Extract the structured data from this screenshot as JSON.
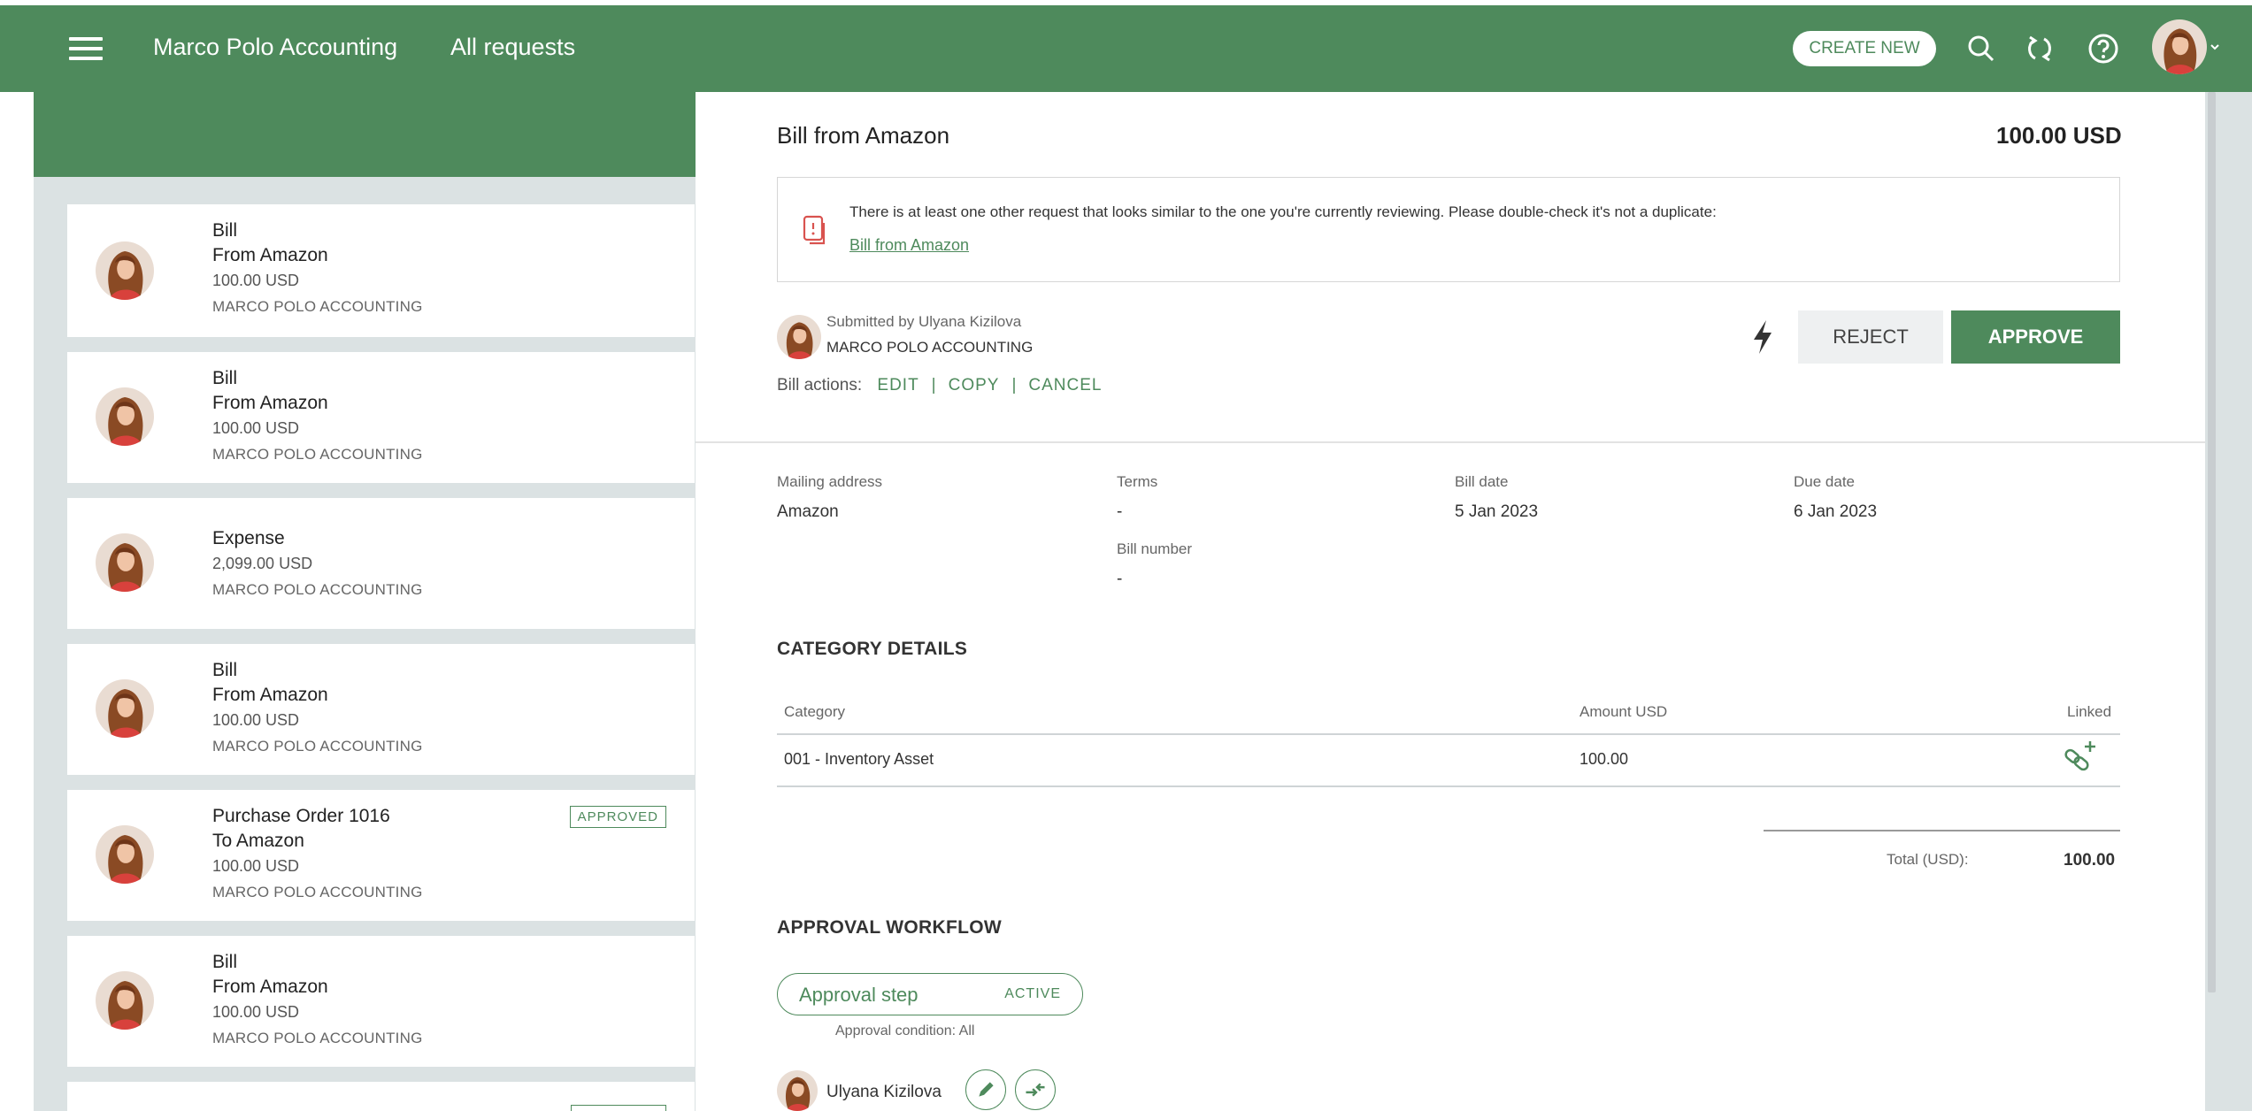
{
  "header": {
    "company": "Marco Polo Accounting",
    "page": "All requests",
    "create_label": "CREATE NEW",
    "icons": [
      "menu-icon",
      "chevron-right-icon",
      "search-icon",
      "sync-icon",
      "help-icon",
      "avatar",
      "caret-down-icon"
    ]
  },
  "colors": {
    "brand": "#4e8a5c",
    "panel": "#dbe2e3",
    "reject_bg": "#eef0f1"
  },
  "requests": [
    {
      "line1": "Bill",
      "line2": "From Amazon",
      "amount": "100.00 USD",
      "org": "MARCO POLO ACCOUNTING",
      "selected": true
    },
    {
      "line1": "Bill",
      "line2": "From Amazon",
      "amount": "100.00 USD",
      "org": "MARCO POLO ACCOUNTING"
    },
    {
      "line1": "Expense",
      "amount": "2,099.00 USD",
      "org": "MARCO POLO ACCOUNTING"
    },
    {
      "line1": "Bill",
      "line2": "From Amazon",
      "amount": "100.00 USD",
      "org": "MARCO POLO ACCOUNTING"
    },
    {
      "line1": "Purchase Order 1016",
      "line2": "To Amazon",
      "amount": "100.00 USD",
      "org": "MARCO POLO ACCOUNTING",
      "badge": "APPROVED"
    },
    {
      "line1": "Bill",
      "line2": "From Amazon",
      "amount": "100.00 USD",
      "org": "MARCO POLO ACCOUNTING"
    }
  ],
  "detail": {
    "title": "Bill from Amazon",
    "amount": "100.00 USD",
    "duplicate_notice": "There is at least one other request that looks similar to the one you're currently reviewing. Please double-check it's not a duplicate:",
    "duplicate_link": "Bill from Amazon",
    "submitted_by": "Submitted by Ulyana Kizilova",
    "submitter_org": "MARCO POLO ACCOUNTING",
    "bill_actions_label": "Bill actions:",
    "actions": {
      "edit": "EDIT",
      "copy": "COPY",
      "cancel": "CANCEL"
    },
    "reject_label": "REJECT",
    "approve_label": "APPROVE",
    "fields": {
      "mailing_address_label": "Mailing address",
      "mailing_address": "Amazon",
      "terms_label": "Terms",
      "terms": "-",
      "bill_number_label": "Bill number",
      "bill_number": "-",
      "bill_date_label": "Bill date",
      "bill_date": "5 Jan 2023",
      "due_date_label": "Due date",
      "due_date": "6 Jan 2023"
    },
    "category_section": "CATEGORY DETAILS",
    "category_table": {
      "headers": {
        "category": "Category",
        "amount": "Amount USD",
        "linked": "Linked"
      },
      "rows": [
        {
          "category": "001 - Inventory Asset",
          "amount": "100.00"
        }
      ]
    },
    "total_label": "Total (USD):",
    "total_value": "100.00",
    "workflow_section": "APPROVAL WORKFLOW",
    "step": {
      "name": "Approval step",
      "status": "ACTIVE",
      "condition": "Approval condition: All"
    },
    "approver": "Ulyana Kizilova"
  }
}
